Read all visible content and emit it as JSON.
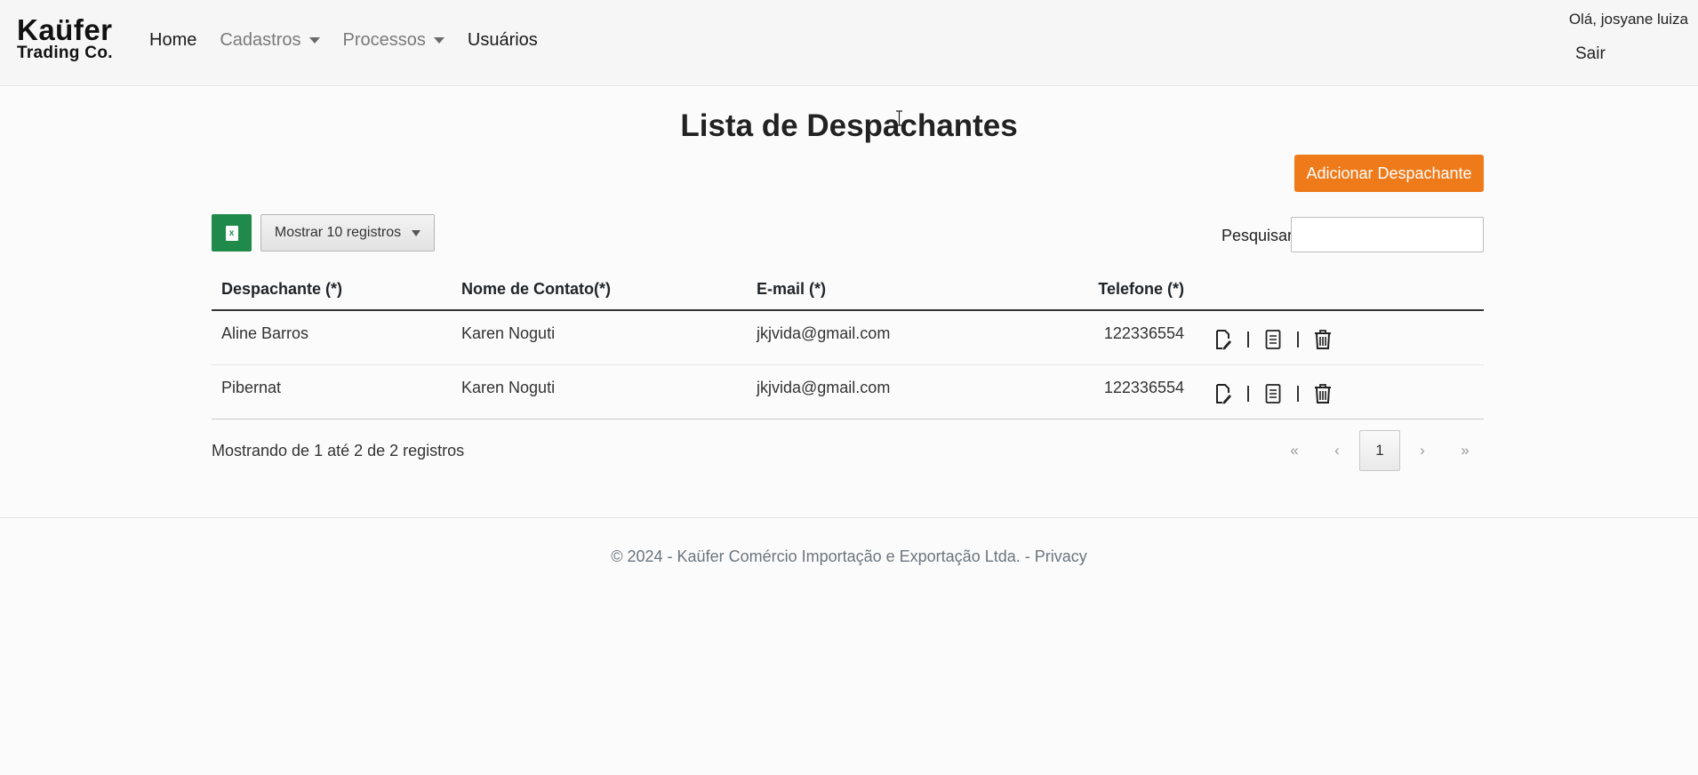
{
  "brand": {
    "line1": "Kaüfer",
    "line2": "Trading Co."
  },
  "nav": {
    "home": "Home",
    "cadastros": "Cadastros",
    "processos": "Processos",
    "usuarios": "Usuários"
  },
  "user": {
    "greeting": "Olá, josyane luiza",
    "logout": "Sair"
  },
  "page": {
    "title": "Lista de Despachantes",
    "add_button": "Adicionar Despachante",
    "page_length": "Mostrar 10 registros",
    "search_label": "Pesquisar",
    "search_value": ""
  },
  "table": {
    "headers": [
      "Despachante (*)",
      "Nome de Contato(*)",
      "E-mail (*)",
      "Telefone (*)"
    ],
    "rows": [
      {
        "despachante": "Aline Barros",
        "contato": "Karen Noguti",
        "email": "jkjvida@gmail.com",
        "telefone": "122336554"
      },
      {
        "despachante": "Pibernat",
        "contato": "Karen Noguti",
        "email": "jkjvida@gmail.com",
        "telefone": "122336554"
      }
    ],
    "info": "Mostrando de 1 até 2 de 2 registros"
  },
  "pagination": {
    "first": "«",
    "prev": "‹",
    "current": "1",
    "next": "›",
    "last": "»"
  },
  "icons": {
    "excel": "file-excel-icon",
    "edit": "edit-document-icon",
    "details": "document-icon",
    "delete": "trash-icon"
  },
  "colors": {
    "accent": "#ef7a1a",
    "excel": "#1f8a4a"
  },
  "footer": {
    "text": "© 2024 - Kaüfer Comércio Importação e Exportação Ltda. - ",
    "privacy": "Privacy"
  }
}
